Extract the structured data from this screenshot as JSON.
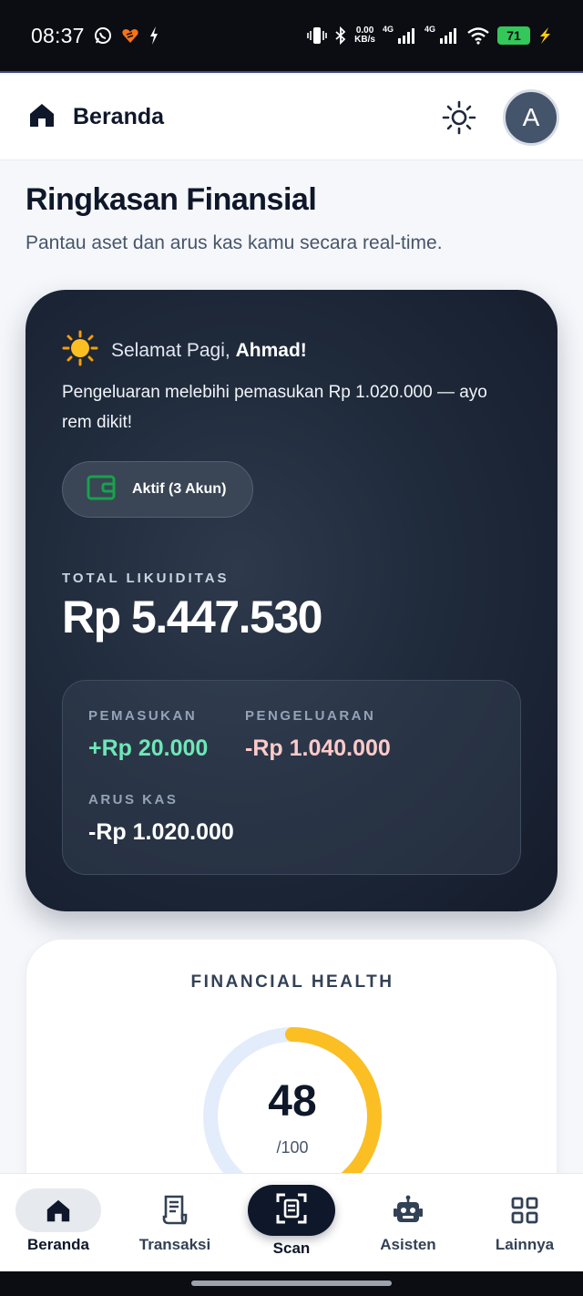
{
  "status_bar": {
    "time": "08:37",
    "net_speed_value": "0.00",
    "net_speed_unit": "KB/s",
    "signal_1_label": "4G",
    "signal_2_label": "4G",
    "battery_level": "71",
    "icons": [
      "whatsapp-icon",
      "app-notification-icon",
      "charging-bolt-icon",
      "vibrate-icon",
      "bluetooth-icon",
      "signal-icon",
      "wifi-icon",
      "battery-icon",
      "charging-icon"
    ]
  },
  "header": {
    "title": "Beranda",
    "avatar_initial": "A",
    "icons": [
      "home-icon",
      "sun-icon"
    ]
  },
  "page": {
    "title": "Ringkasan Finansial",
    "subtitle": "Pantau aset dan arus kas kamu secara real-time."
  },
  "summary_card": {
    "greeting_prefix": "Selamat Pagi,",
    "greeting_name": "Ahmad!",
    "alert": "Pengeluaran melebihi pemasukan Rp 1.020.000 — ayo rem dikit!",
    "account_chip": "Aktif (3 Akun)",
    "liquidity_label": "TOTAL LIKUIDITAS",
    "liquidity_value": "Rp 5.447.530",
    "income_label": "PEMASUKAN",
    "income_value": "+Rp 20.000",
    "expense_label": "PENGELUARAN",
    "expense_value": "-Rp 1.040.000",
    "cashflow_label": "ARUS KAS",
    "cashflow_value": "-Rp 1.020.000",
    "colors": {
      "income": "#6ee7b7",
      "expense": "#fecaca",
      "wallet_icon": "#22c55e"
    }
  },
  "health_card": {
    "title": "FINANCIAL HEALTH",
    "score": "48",
    "max": "/100",
    "score_fraction": 0.48,
    "colors": {
      "progress": "#fbbf24",
      "track": "#e3ecfb"
    }
  },
  "bottom_nav": {
    "items": [
      {
        "label": "Beranda",
        "icon": "home-icon",
        "active": true
      },
      {
        "label": "Transaksi",
        "icon": "receipt-icon",
        "active": false
      },
      {
        "label": "Scan",
        "icon": "scan-icon",
        "active": false
      },
      {
        "label": "Asisten",
        "icon": "robot-icon",
        "active": false
      },
      {
        "label": "Lainnya",
        "icon": "grid-icon",
        "active": false
      }
    ]
  }
}
